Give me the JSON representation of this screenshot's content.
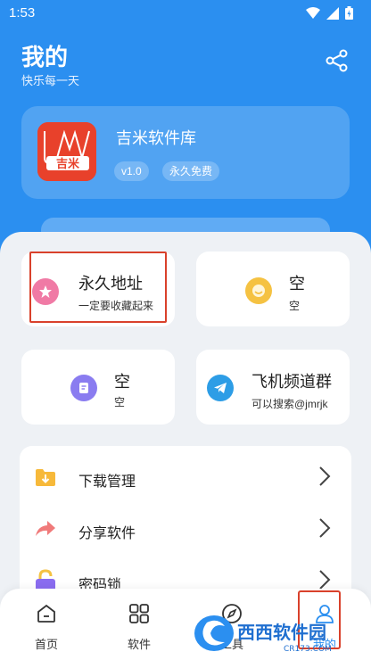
{
  "status_bar": {
    "time": "1:53"
  },
  "header": {
    "title": "我的",
    "subtitle": "快乐每一天"
  },
  "app_card": {
    "name": "吉米软件库",
    "version": "v1.0",
    "license": "永久免费",
    "logo_text": "吉米"
  },
  "tiles": [
    {
      "title": "永久地址",
      "subtitle": "一定要收藏起来",
      "icon": "star-icon",
      "color": "#f07aa5"
    },
    {
      "title": "空",
      "subtitle": "空",
      "icon": "smile-icon",
      "color": "#f5c242"
    },
    {
      "title": "空",
      "subtitle": "空",
      "icon": "note-icon",
      "color": "#8a7cf0"
    },
    {
      "title": "飞机频道群",
      "subtitle": "可以搜索@jmrjk",
      "icon": "telegram-icon",
      "color": "#2d9de6"
    }
  ],
  "menu": [
    {
      "label": "下载管理",
      "icon": "folder-download-icon"
    },
    {
      "label": "分享软件",
      "icon": "share-arrow-icon"
    },
    {
      "label": "密码锁",
      "icon": "lock-icon"
    }
  ],
  "tabs": [
    {
      "label": "首页",
      "icon": "home-icon"
    },
    {
      "label": "软件",
      "icon": "grid-icon"
    },
    {
      "label": "工具",
      "icon": "compass-icon"
    },
    {
      "label": "我的",
      "icon": "user-icon"
    }
  ],
  "watermark": {
    "text": "西西软件园",
    "sub": "CR173.COM"
  },
  "colors": {
    "primary": "#2b8ff0",
    "highlight": "#d9412b"
  }
}
